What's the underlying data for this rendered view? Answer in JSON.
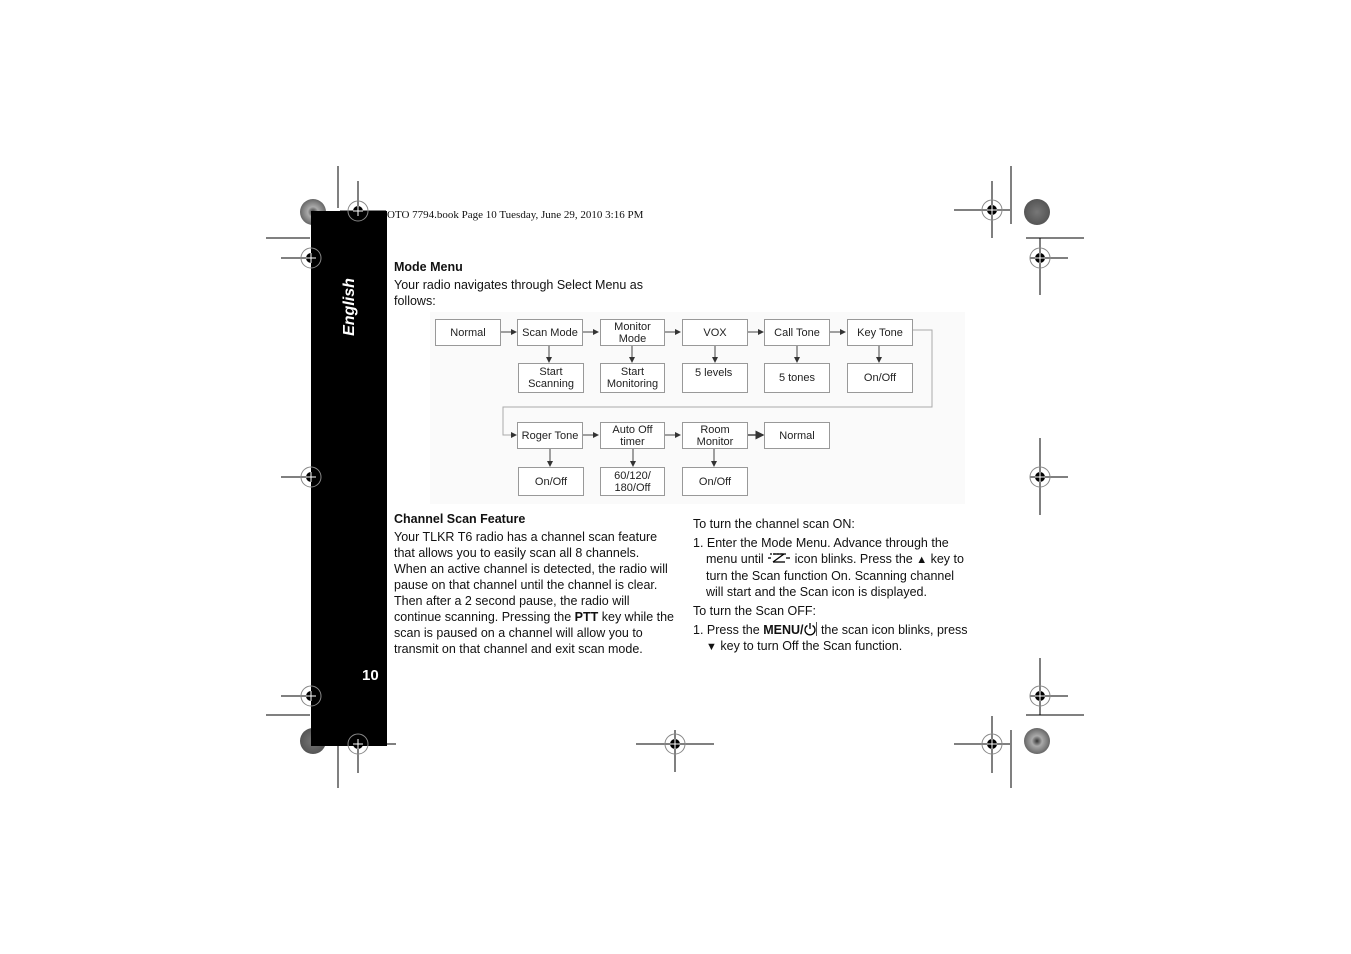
{
  "header": {
    "print_info": "OTO 7794.book  Page 10  Tuesday, June 29, 2010  3:16 PM"
  },
  "sidebar": {
    "language": "English",
    "page_number": "10"
  },
  "mode_menu": {
    "title": "Mode Menu",
    "intro": "Your radio navigates through Select Menu as follows:",
    "diagram": {
      "row1": [
        {
          "label": "Normal",
          "sub": null
        },
        {
          "label": "Scan Mode",
          "sub": "Start Scanning"
        },
        {
          "label": "Monitor Mode",
          "sub": "Start Monitoring"
        },
        {
          "label": "VOX",
          "sub": "5 levels"
        },
        {
          "label": "Call Tone",
          "sub": "5 tones"
        },
        {
          "label": "Key Tone",
          "sub": "On/Off"
        }
      ],
      "row2": [
        {
          "label": "Roger Tone",
          "sub": "On/Off"
        },
        {
          "label": "Auto Off timer",
          "sub": "60/120/ 180/Off"
        },
        {
          "label": "Room Monitor",
          "sub": "On/Off"
        },
        {
          "label": "Normal",
          "sub": null
        }
      ]
    }
  },
  "channel_scan": {
    "title": "Channel Scan Feature",
    "body_pre": "Your TLKR T6 radio has a channel scan feature that allows you to easily scan all 8 channels. When an active channel is detected, the radio will pause on that channel until the channel is clear. Then after a 2 second pause, the radio will continue scanning. Pressing the ",
    "body_bold": "PTT",
    "body_post": " key while the scan is paused on a channel will allow you to transmit on that channel and exit scan mode."
  },
  "scan_on": {
    "heading": "To turn the channel scan ON:",
    "step_a": "1. Enter the Mode Menu. Advance through the menu until ",
    "step_b": " icon blinks. Press the ",
    "up_key": "▲",
    "step_c": " key to turn the Scan function On. Scanning channel will start and the Scan icon is displayed."
  },
  "scan_off": {
    "heading": "To turn the Scan OFF:",
    "step_a": "1. Press the ",
    "menu_bold": "MENU/",
    "step_b": " the scan icon blinks, press ",
    "down_key": "▼",
    "step_c": " key to turn Off the Scan function."
  }
}
